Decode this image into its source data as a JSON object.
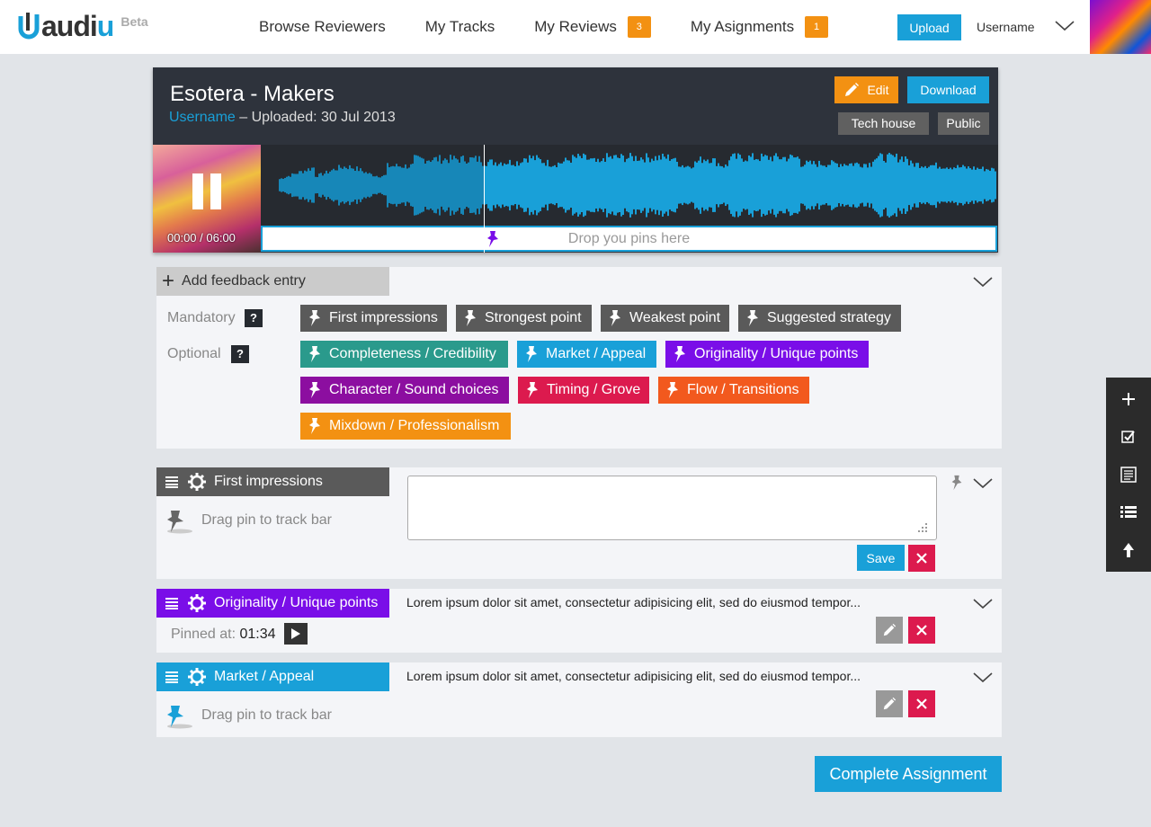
{
  "brand": {
    "name_prefix": "a",
    "name_middle": "udi",
    "name_suffix": "u",
    "beta": "Beta"
  },
  "nav": {
    "browse": "Browse Reviewers",
    "tracks": "My Tracks",
    "reviews": "My Reviews",
    "reviews_count": "3",
    "assignments": "My Asignments",
    "assignments_count": "1"
  },
  "header": {
    "upload": "Upload",
    "username": "Username"
  },
  "track": {
    "title": "Esotera - Makers",
    "owner": "Username",
    "uploaded": " – Uploaded: 30 Jul 2013",
    "edit": "Edit",
    "download": "Download",
    "genre": "Tech house",
    "visibility": "Public",
    "time": "00:00 / 06:00",
    "pin_zone": "Drop you pins here"
  },
  "feedback": {
    "add_entry": "Add feedback entry",
    "mandatory_label": "Mandatory",
    "optional_label": "Optional",
    "help": "?",
    "mandatory": [
      {
        "label": "First impressions",
        "color": "#5a5a5a"
      },
      {
        "label": "Strongest point",
        "color": "#5a5a5a"
      },
      {
        "label": "Weakest point",
        "color": "#5a5a5a"
      },
      {
        "label": "Suggested strategy",
        "color": "#5a5a5a"
      }
    ],
    "optional": [
      {
        "label": "Completeness / Credibility",
        "color": "#2a9a8c"
      },
      {
        "label": "Market / Appeal",
        "color": "#19a0d8"
      },
      {
        "label": "Originality / Unique points",
        "color": "#7a0ee8"
      },
      {
        "label": "Character / Sound choices",
        "color": "#8c0ea0"
      },
      {
        "label": "Timing / Grove",
        "color": "#dc1a4e"
      },
      {
        "label": "Flow / Transitions",
        "color": "#f2591e"
      },
      {
        "label": "Mixdown / Professionalism",
        "color": "#f39112"
      }
    ]
  },
  "entries": [
    {
      "title": "First impressions",
      "color": "#5a5a5a",
      "hint": "Drag pin to track bar",
      "save": "Save"
    },
    {
      "title": "Originality / Unique points",
      "color": "#7a0ee8",
      "text": "Lorem ipsum dolor sit amet, consectetur adipisicing elit, sed do eiusmod tempor...",
      "pinned_label": "Pinned at: ",
      "pinned_time": "01:34"
    },
    {
      "title": "Market / Appeal",
      "color": "#19a0d8",
      "text": "Lorem ipsum dolor sit amet, consectetur adipisicing elit, sed do eiusmod tempor...",
      "hint": "Drag pin to track bar"
    }
  ],
  "complete": "Complete Assignment",
  "side_icons": [
    "plus-icon",
    "checkbox-icon",
    "document-icon",
    "list-icon",
    "arrow-up-icon"
  ]
}
